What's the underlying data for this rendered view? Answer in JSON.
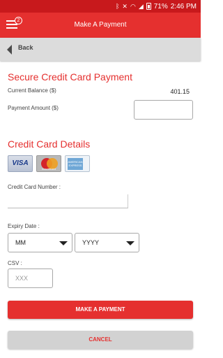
{
  "status_bar": {
    "battery": "71%",
    "time": "2:46 PM",
    "icons": [
      "bluetooth-icon",
      "mute-icon",
      "wifi-icon",
      "signal-icon",
      "battery-icon"
    ]
  },
  "header": {
    "title": "Make A Payment",
    "menu_badge": "2",
    "color": "#e5302f"
  },
  "nav": {
    "back_label": "Back"
  },
  "payment": {
    "heading": "Secure Credit Card Payment",
    "balance_label": "Current Balance ($)",
    "balance_value": "401.15",
    "amount_label": "Payment Amount ($)",
    "amount_value": ""
  },
  "card_details": {
    "heading": "Credit Card Details",
    "logos": {
      "visa": "VISA",
      "mastercard": "mastercard",
      "amex": "AMERICAN EXPRESS"
    },
    "number_label": "Credit Card Number :",
    "expiry_label": "Expiry Date :",
    "month_value": "MM",
    "year_value": "YYYY",
    "csv_label": "CSV :",
    "csv_placeholder": "XXX"
  },
  "buttons": {
    "pay": "MAKE A PAYMENT",
    "cancel": "CANCEL"
  }
}
